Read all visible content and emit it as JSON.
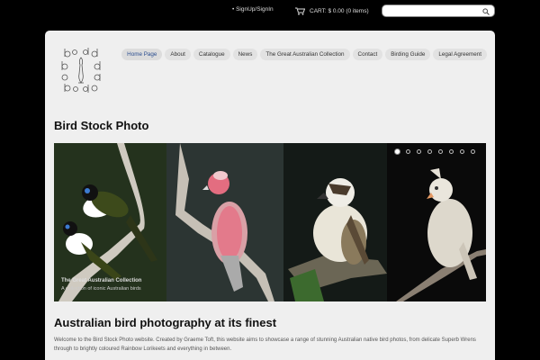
{
  "topbar": {
    "signup_label": "• SignUp/SignIn",
    "cart_label": "CART: $ 0.00 (0 items)",
    "search": {
      "value": "",
      "placeholder": ""
    }
  },
  "logo": {
    "text": "bird stock photo"
  },
  "nav": {
    "items": [
      {
        "label": "Home Page",
        "active": true
      },
      {
        "label": "About"
      },
      {
        "label": "Catalogue"
      },
      {
        "label": "News"
      },
      {
        "label": "The Great Australian Collection"
      },
      {
        "label": "Contact"
      },
      {
        "label": "Birding Guide"
      },
      {
        "label": "Legal Agreement"
      }
    ]
  },
  "page_title": "Bird Stock Photo",
  "slider": {
    "caption_title": "The Great Australian Collection",
    "caption_subtitle": "A collection of iconic Australian birds",
    "dot_count": 8,
    "active_dot": 1
  },
  "content": {
    "heading": "Australian bird photography at its finest",
    "intro": "Welcome to the Bird Stock Photo website. Created by Graeme Toft, this website aims to showcase a range of stunning Australian native bird photos, from delicate Superb Wrens through to brightly coloured Rainbow Lorikeets and everything in between."
  }
}
